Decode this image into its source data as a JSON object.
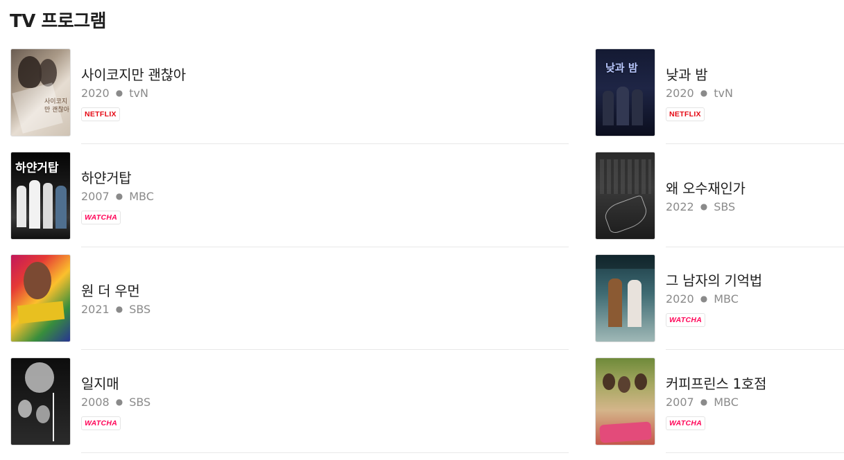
{
  "section": {
    "title": "TV 프로그램"
  },
  "left": [
    {
      "title": "사이코지만 괜찮아",
      "year": "2020",
      "channel": "tvN",
      "badge": "NETFLIX",
      "poster_icon": "poster-psycho-but-its-okay",
      "poster_text": "사이코지만 괜찮아"
    },
    {
      "title": "하얀거탑",
      "year": "2007",
      "channel": "MBC",
      "badge": "WATCHA",
      "poster_icon": "poster-white-tower",
      "poster_text": "하얀거탑"
    },
    {
      "title": "원 더 우먼",
      "year": "2021",
      "channel": "SBS",
      "badge": "",
      "poster_icon": "poster-one-the-woman",
      "poster_text": ""
    },
    {
      "title": "일지매",
      "year": "2008",
      "channel": "SBS",
      "badge": "WATCHA",
      "poster_icon": "poster-iljimae",
      "poster_text": ""
    }
  ],
  "right": [
    {
      "title": "낮과 밤",
      "year": "2020",
      "channel": "tvN",
      "badge": "NETFLIX",
      "poster_icon": "poster-awaken",
      "poster_text": "낮과 밤"
    },
    {
      "title": "왜 오수재인가",
      "year": "2022",
      "channel": "SBS",
      "badge": "",
      "poster_icon": "poster-why-her",
      "poster_text": ""
    },
    {
      "title": "그 남자의 기억법",
      "year": "2020",
      "channel": "MBC",
      "badge": "WATCHA",
      "poster_icon": "poster-find-me-in-your-memory",
      "poster_text": ""
    },
    {
      "title": "커피프린스 1호점",
      "year": "2007",
      "channel": "MBC",
      "badge": "WATCHA",
      "poster_icon": "poster-coffee-prince",
      "poster_text": ""
    }
  ],
  "colors": {
    "netflix": "#e50914",
    "watcha": "#ff0558"
  }
}
